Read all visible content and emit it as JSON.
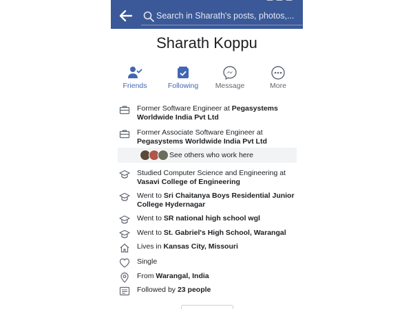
{
  "header": {
    "search_placeholder": "Search in Sharath's posts, photos,..."
  },
  "profile": {
    "name": "Sharath Koppu"
  },
  "actions": [
    {
      "label": "Friends"
    },
    {
      "label": "Following"
    },
    {
      "label": "Message"
    },
    {
      "label": "More"
    }
  ],
  "about": {
    "work1": {
      "prefix": "Former Software Engineer at ",
      "org": "Pegasystems Worldwide India Pvt Ltd"
    },
    "work2": {
      "prefix": "Former Associate Software Engineer at ",
      "org": "Pegasystems Worldwide India Pvt Ltd"
    },
    "see_others": "See others who work here",
    "edu1": {
      "prefix": "Studied Computer Science and Engineering at ",
      "org": "Vasavi College of Engineering"
    },
    "edu2": {
      "prefix": "Went to ",
      "org": "Sri Chaitanya Boys Residential Junior College Hydernagar"
    },
    "edu3": {
      "prefix": "Went to ",
      "org": "SR national high school wgl"
    },
    "edu4": {
      "prefix": "Went to ",
      "org": "St. Gabriel's High School, Warangal"
    },
    "lives": {
      "prefix": "Lives in ",
      "place": "Kansas City, Missouri"
    },
    "relationship": "Single",
    "from": {
      "prefix": "From ",
      "place": "Warangal, India"
    },
    "followed": {
      "prefix": "Followed by ",
      "count": "23 people"
    }
  },
  "colors": {
    "brand_blue": "#3b5998",
    "accent_blue": "#4267b2",
    "icon_gray": "#606770"
  }
}
